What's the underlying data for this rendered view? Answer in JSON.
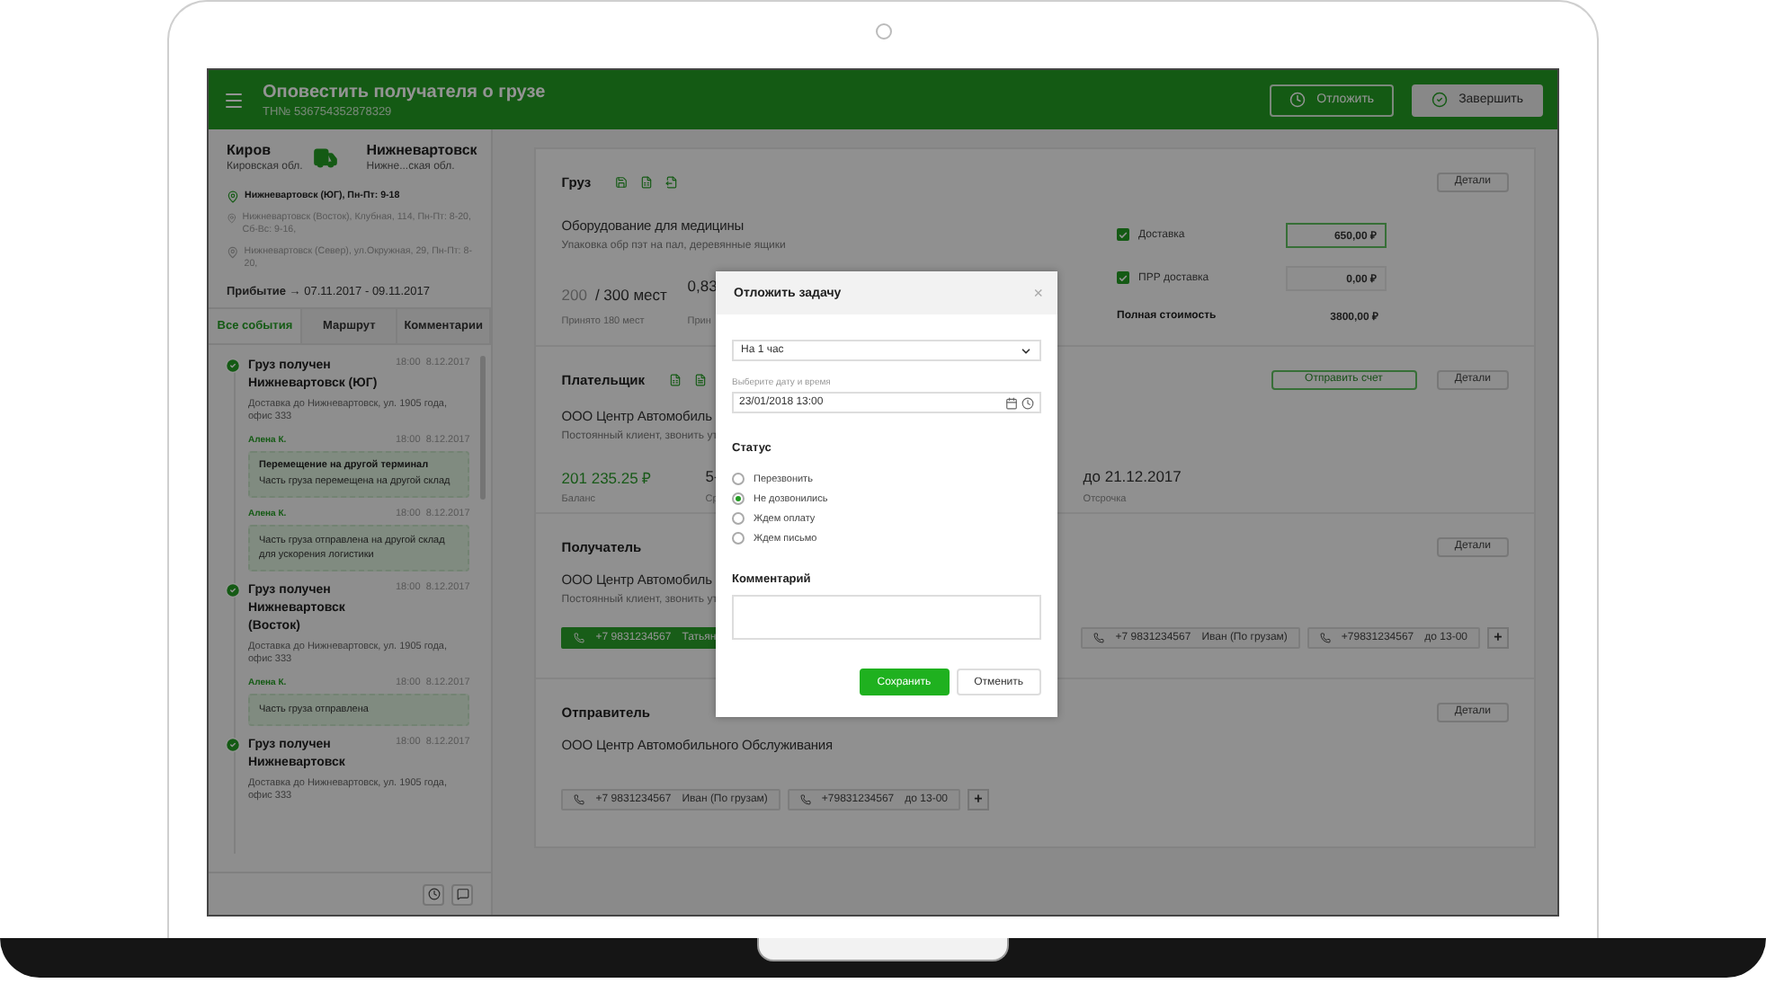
{
  "header": {
    "title": "Оповестить получателя о грузе",
    "subtitle": "ТН№ 536754352878329",
    "buttons": [
      {
        "label": "Отложить",
        "kind": "outline"
      },
      {
        "label": "Завершить",
        "kind": "filled"
      }
    ]
  },
  "route": {
    "from": {
      "city": "Киров",
      "region": "Кировская обл."
    },
    "to": {
      "city": "Нижневартовск",
      "region": "Нижне...ская обл."
    },
    "addresses": [
      {
        "text": "Нижневартовск (ЮГ), Пн-Пт: 9-18",
        "selected": true
      },
      {
        "text": "Нижневартовск (Восток), Клубная, 114, Пн-Пт: 8-20, Сб-Вс: 9-16,",
        "selected": false
      },
      {
        "text": "Нижневартовск (Север), ул.Окружная, 29, Пн-Пт: 8-20,",
        "selected": false
      }
    ],
    "arrival": "**Прибытие** → 07.11.2017 - 09.11.2017"
  },
  "tabs": [
    {
      "label": "Все события",
      "selected": true
    },
    {
      "label": "Маршрут",
      "selected": false
    },
    {
      "label": "Комментарии",
      "selected": false
    }
  ],
  "events": [
    {
      "kind": "event",
      "status": "Груз получен",
      "place": "Нижневартовск (ЮГ)",
      "time": "18:00",
      "date": "8.12.2017",
      "text": "Доставка до Нижневартовск, ул. 1905 года, офис 333"
    },
    {
      "kind": "note",
      "author": "Алена К.",
      "time": "18:00",
      "date": "8.12.2017",
      "title": "Перемещение на другой терминал",
      "text": "Часть груза перемещена на другой склад"
    },
    {
      "kind": "note",
      "author": "Алена К.",
      "time": "18:00",
      "date": "8.12.2017",
      "text": "Часть груза отправлена на другой склад для ускорения логистики"
    },
    {
      "kind": "event",
      "status": "Груз получен",
      "place": "Нижневартовск (Восток)",
      "time": "18:00",
      "date": "8.12.2017",
      "text": "Доставка до Нижневартовск, ул. 1905 года, офис 333"
    },
    {
      "kind": "note",
      "author": "Алена К.",
      "time": "18:00",
      "date": "8.12.2017",
      "text": "Часть груза отправлена"
    },
    {
      "kind": "event",
      "status": "Груз получен",
      "place": "Нижневартовск",
      "time": "18:00",
      "date": "8.12.2017",
      "text": "Доставка до Нижневартовск, ул. 1905 года, офис 333"
    }
  ],
  "cargo": {
    "title": "Груз",
    "details_button": "Детали",
    "name": "Оборудование для медицины",
    "packaging": "Упаковка обр пэт на пал, деревянные ящики",
    "places_accepted": "200",
    "places_total": "/ 300 мест",
    "places_note": "Принято 180 мест",
    "volume": "0,83",
    "volume_note": "Прин",
    "costs": [
      {
        "label": "Доставка",
        "checked": true,
        "value": "650,00 ₽",
        "selected": true
      },
      {
        "label": "ПРР доставка",
        "checked": true,
        "value": "0,00 ₽",
        "selected": false
      }
    ],
    "total": {
      "label": "Полная стоимость",
      "value": "3800,00 ₽"
    }
  },
  "payer": {
    "title": "Плательщик",
    "send_button": "Отправить счет",
    "details_button": "Детали",
    "company": "ООО  Центр Автомобиль",
    "note": "Постоянный клиент, звонить  ут",
    "stats": [
      {
        "value": "201 235.25 ₽",
        "label": "Баланс",
        "kind": "money"
      },
      {
        "value": "5-",
        "label": "Ср",
        "kind": "plain"
      },
      {
        "value": "до 21.12.2017",
        "label": "Отсрочка",
        "kind": "plain"
      }
    ]
  },
  "recipient": {
    "title": "Получатель",
    "details_button": "Детали",
    "company": "ООО  Центр Автомобиль",
    "note": "Постоянный клиент, звонить  ут",
    "phones": [
      {
        "phone": "+7 9831234567",
        "name": "Татьян",
        "selected": true
      },
      {
        "phone": "+7 9831234567",
        "name": "Иван (По грузам)",
        "selected": false
      },
      {
        "phone": "+79831234567",
        "name": "до 13-00",
        "selected": false
      }
    ],
    "add_button": "+"
  },
  "sender": {
    "title": "Отправитель",
    "details_button": "Детали",
    "company": "ООО  Центр Автомобильного Обслуживания",
    "phones": [
      {
        "phone": "+7 9831234567",
        "name": "Иван (По грузам)",
        "selected": false
      },
      {
        "phone": "+79831234567",
        "name": "до 13-00",
        "selected": false
      }
    ],
    "add_button": "+"
  },
  "modal": {
    "title": "Отложить задачу",
    "close": "×",
    "select_value": "На 1 час",
    "date_label": "Выберите дату и время",
    "date_value": "23/01/2018  13:00",
    "status_title": "Статус",
    "statuses": [
      {
        "label": "Перезвонить",
        "selected": false
      },
      {
        "label": "Не дозвонились",
        "selected": true
      },
      {
        "label": "Ждем оплату",
        "selected": false
      },
      {
        "label": "Ждем письмо",
        "selected": false
      }
    ],
    "comment_title": "Комментарий",
    "buttons": [
      {
        "label": "Сохранить",
        "kind": "primary"
      },
      {
        "label": "Отменить",
        "kind": "secondary"
      }
    ]
  }
}
